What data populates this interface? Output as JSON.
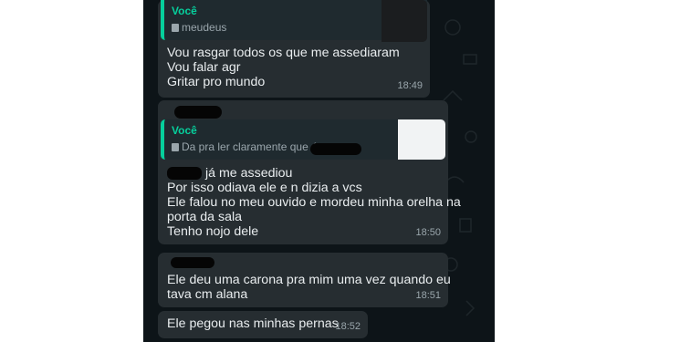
{
  "messages": [
    {
      "quote_author": "Você",
      "quote_text": "meudeus",
      "lines": [
        "Vou rasgar todos os que me assediaram",
        "Vou falar agr",
        "Gritar pro mundo"
      ],
      "time": "18:49"
    },
    {
      "quote_author": "Você",
      "quote_text": "Da pra ler claramente que é o",
      "lines": [
        "já me assediou",
        "Por isso odiava ele e n dizia a vcs",
        "Ele falou no meu ouvido e mordeu minha orelha na",
        "porta da sala",
        "Tenho nojo dele"
      ],
      "time": "18:50"
    },
    {
      "lines": [
        "Ele deu uma carona pra mim uma vez quando eu",
        "tava cm alana"
      ],
      "time": "18:51"
    },
    {
      "lines": [
        "Ele pegou nas minhas pernas"
      ],
      "time": "18:52"
    }
  ],
  "colors": {
    "chat_bg": "#0d1418",
    "bubble": "#262d31",
    "accent": "#06cf9c",
    "meta": "#9aa6ac"
  },
  "icons": {
    "quoted_media": "image-icon"
  }
}
